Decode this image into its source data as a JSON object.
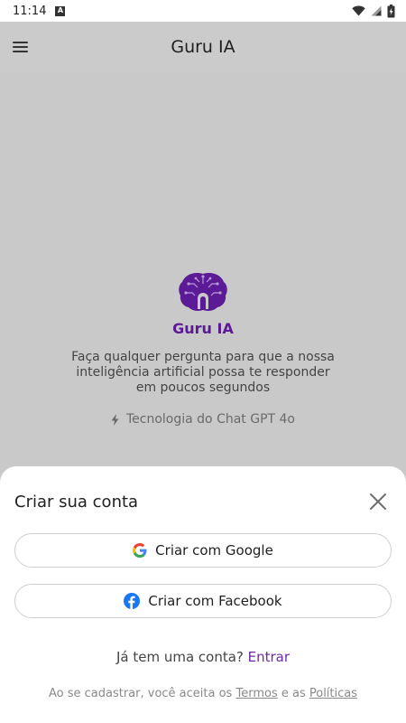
{
  "status_bar": {
    "time": "11:14",
    "badge": "A",
    "icons": [
      "wifi-icon",
      "signal-icon",
      "battery-icon"
    ]
  },
  "app_bar": {
    "title": "Guru IA",
    "menu_icon": "hamburger-menu-icon"
  },
  "hero": {
    "name": "Guru IA",
    "description": "Faça qualquer pergunta para que a nossa inteligência artificial possa te responder em poucos segundos",
    "tech": "Tecnologia do Chat GPT 4o",
    "tech_icon": "lightning-bolt-icon",
    "logo_icon": "brain-chip-logo-icon"
  },
  "sheet": {
    "title": "Criar sua conta",
    "close_icon": "close-icon",
    "google_label": "Criar com Google",
    "facebook_label": "Criar com Facebook",
    "login_prompt": "Já tem uma conta? ",
    "login_link": "Entrar",
    "legal_prefix": "Ao se cadastrar, você aceita os ",
    "legal_terms": "Termos",
    "legal_mid": " e as ",
    "legal_policies": "Políticas"
  },
  "colors": {
    "accent": "#5b1a96",
    "link": "#6b2aa8",
    "overlay": "#c9c9c9",
    "google_blue": "#4285F4",
    "facebook_blue": "#1877F2"
  }
}
